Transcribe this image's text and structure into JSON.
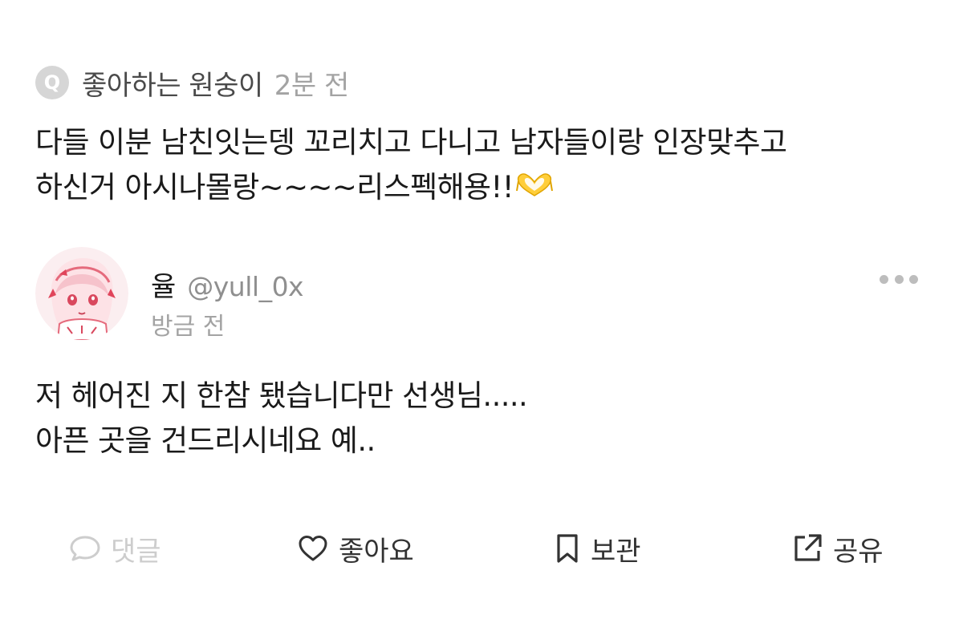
{
  "question": {
    "badge": "Q",
    "asker": "좋아하는 원숭이",
    "time": "2분 전",
    "text_lines": [
      "다들 이분 남친잇는뎅 꼬리치고 다니고 남자들이랑 인장맞추고",
      "하신거 아시나몰랑~~~~리스펙해용!!"
    ],
    "emoji_icon": "heart-hands-emoji"
  },
  "answer": {
    "author_name": "율",
    "author_handle": "@yull_0x",
    "time": "방금 전",
    "avatar_icon": "anime-girl-avatar",
    "text_lines": [
      "저 헤어진 지 한참 됐습니다만 선생님.....",
      "아픈 곳을 건드리시네요 예.."
    ],
    "more_icon": "more-dots-icon"
  },
  "actions": {
    "comment": {
      "label": "댓글",
      "icon": "comment-bubble-icon",
      "color": "#cdcdcd"
    },
    "like": {
      "label": "좋아요",
      "icon": "heart-outline-icon"
    },
    "save": {
      "label": "보관",
      "icon": "bookmark-icon"
    },
    "share": {
      "label": "공유",
      "icon": "share-external-icon"
    }
  }
}
